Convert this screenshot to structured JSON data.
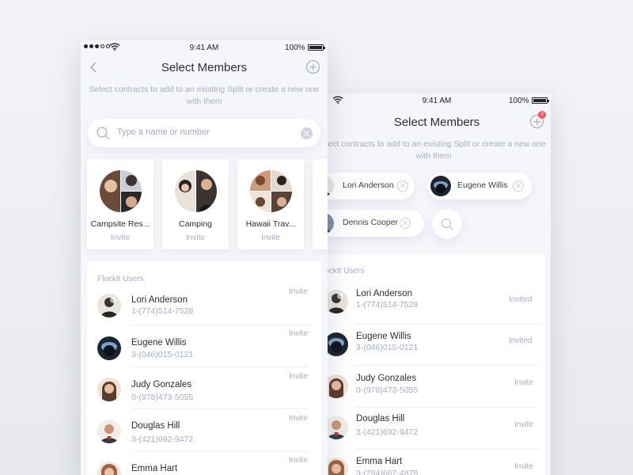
{
  "status_bar": {
    "time": "9:41 AM",
    "battery": "100%"
  },
  "back_screen": {
    "title": "Select Members",
    "subtitle": "elect contracts to add to an existing Split or create a new one with them",
    "badge_count": "3",
    "selected": [
      {
        "name": "Lori Anderson"
      },
      {
        "name": "Eugene Willis"
      },
      {
        "name": "Dennis Cooper"
      }
    ],
    "section_label": "lockIt Users",
    "users": [
      {
        "name": "Lori Anderson",
        "phone": "1-(774)514-7528",
        "status": "Invited"
      },
      {
        "name": "Eugene Willis",
        "phone": "3-(046)015-0121",
        "status": "Invited"
      },
      {
        "name": "Judy Gonzales",
        "phone": "0-(978)473-5055",
        "status": "Invite"
      },
      {
        "name": "Douglas Hill",
        "phone": "3-(421)692-9472",
        "status": "Invite"
      },
      {
        "name": "Emma Hart",
        "phone": "3-(294)667-4878",
        "status": "Invite"
      }
    ]
  },
  "front_screen": {
    "title": "Select Members",
    "subtitle": "Select contracts to add to an existing Split or create a new one with them",
    "search": {
      "placeholder": "Type a name or number"
    },
    "groups": [
      {
        "name": "Campsite Res...",
        "action": "Invite"
      },
      {
        "name": "Camping",
        "action": "Invite"
      },
      {
        "name": "Hawaii Trav...",
        "action": "Invite"
      }
    ],
    "section_label": "FlockIt Users",
    "users": [
      {
        "name": "Lori Anderson",
        "phone": "1-(774)514-7528",
        "status": "Invite"
      },
      {
        "name": "Eugene Willis",
        "phone": "3-(046)015-0121",
        "status": "Invite"
      },
      {
        "name": "Judy Gonzales",
        "phone": "0-(978)473-5055",
        "status": "Invite"
      },
      {
        "name": "Douglas Hill",
        "phone": "3-(421)692-9472",
        "status": "Invite"
      },
      {
        "name": "Emma Hart",
        "phone": "",
        "status": "Invite"
      }
    ]
  },
  "colors": {
    "accent_text": "#a6acc5",
    "badge": "#f2545b",
    "background": "#eef0f4"
  }
}
